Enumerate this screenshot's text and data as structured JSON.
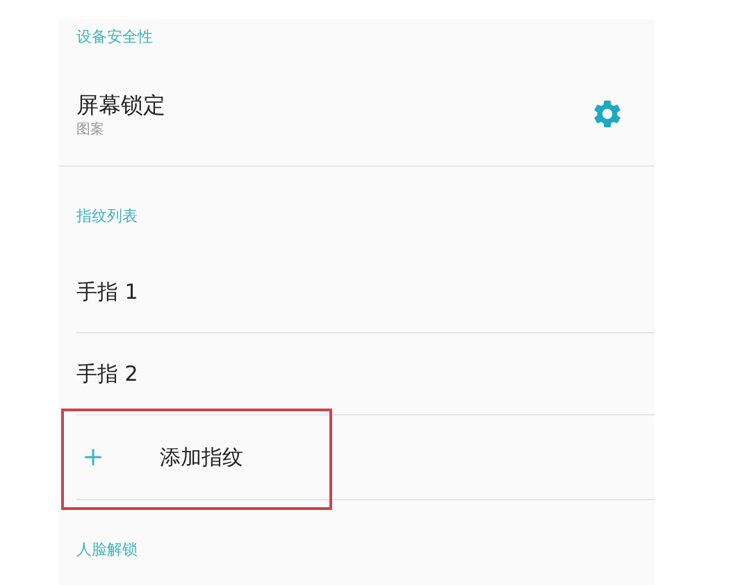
{
  "device_security": {
    "header": "设备安全性",
    "screen_lock": {
      "title": "屏幕锁定",
      "summary": "图案"
    }
  },
  "fingerprint_list": {
    "header": "指纹列表",
    "fingers": [
      "手指 1",
      "手指 2"
    ],
    "add": {
      "label": "添加指纹",
      "highlighted": true
    }
  },
  "face_unlock": {
    "header": "人脸解锁"
  }
}
